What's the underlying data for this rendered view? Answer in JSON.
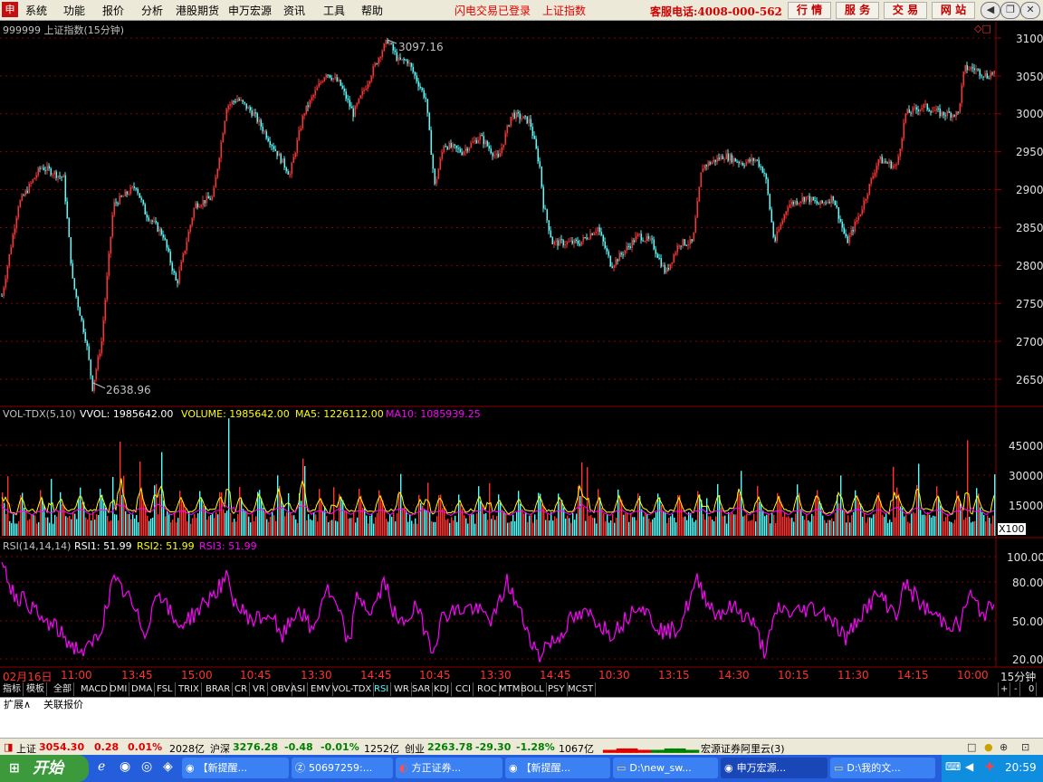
{
  "menu": {
    "items": [
      "系统",
      "功能",
      "报价",
      "分析",
      "港股期货",
      "申万宏源",
      "资讯",
      "工具",
      "帮助"
    ],
    "status_login": "闪电交易已登录",
    "status_index": "上证指数",
    "hotline": "客服电话:4008-000-562",
    "buttons": [
      "行 情",
      "服 务",
      "交 易",
      "网 站"
    ]
  },
  "main_chart": {
    "title": "999999 上证指数(15分钟)",
    "high_label": "3097.16",
    "low_label": "2638.96",
    "y_ticks": [
      "3100",
      "3050",
      "3000",
      "2950",
      "2900",
      "2850",
      "2800",
      "2750",
      "2700",
      "2650"
    ]
  },
  "volume_panel": {
    "name": "VOL-TDX(5,10)",
    "vvol": "VVOL: 1985642.00",
    "volume": "VOLUME: 1985642.00",
    "ma5": "MA5: 1226112.00",
    "ma10": "MA10: 1085939.25",
    "y_ticks": [
      "45000",
      "30000",
      "15000"
    ],
    "unit": "X100"
  },
  "rsi_panel": {
    "name": "RSI(14,14,14)",
    "rsi1": "RSI1: 51.99",
    "rsi2": "RSI2: 51.99",
    "rsi3": "RSI3: 51.99",
    "y_ticks": [
      "100.00",
      "80.00",
      "50.00",
      "20.00"
    ]
  },
  "time_axis": {
    "labels": [
      "02月16日",
      "11:00",
      "13:45",
      "15:00",
      "10:45",
      "13:30",
      "14:45",
      "10:45",
      "13:30",
      "14:45",
      "10:30",
      "13:15",
      "14:30",
      "10:15",
      "11:30",
      "14:15",
      "10:00"
    ],
    "period": "15分钟"
  },
  "indicator_tabs": [
    "指标",
    "模板",
    "全部",
    "MACD",
    "DMI",
    "DMA",
    "FSL",
    "TRIX",
    "BRAR",
    "CR",
    "VR",
    "OBV",
    "ASI",
    "EMV",
    "VOL-TDX",
    "RSI",
    "WR",
    "SAR",
    "KDJ",
    "CCI",
    "ROC",
    "MTM",
    "BOLL",
    "PSY",
    "MCST"
  ],
  "indicator_controls": [
    "+",
    "-",
    "0"
  ],
  "bottom_tabs": [
    "扩展∧",
    "关联报价"
  ],
  "ticker": {
    "sh_label": "上证",
    "sh_value": "3054.30",
    "sh_change": "0.28",
    "sh_pct": "0.01%",
    "sh_amount": "2028亿",
    "hs_label": "沪深",
    "hs_value": "3276.28",
    "hs_change": "-0.48",
    "hs_pct": "-0.01%",
    "hs_amount": "1252亿",
    "cy_label": "创业",
    "cy_value": "2263.78",
    "cy_change": "-29.30",
    "cy_pct": "-1.28%",
    "cy_amount": "1067亿",
    "server": "宏源证券阿里云(3)"
  },
  "taskbar": {
    "start": "开始",
    "items": [
      "【新提醒...",
      "50697259:...",
      "方正证券...",
      "【新提醒...",
      "D:\\new_sw...",
      "申万宏源...",
      "D:\\我的文..."
    ],
    "clock": "20:59"
  },
  "colors": {
    "up": "#ff3232",
    "down": "#54fcfc",
    "yellow": "#ffff00",
    "magenta": "#ff00ff",
    "grid": "#8b0000"
  }
}
